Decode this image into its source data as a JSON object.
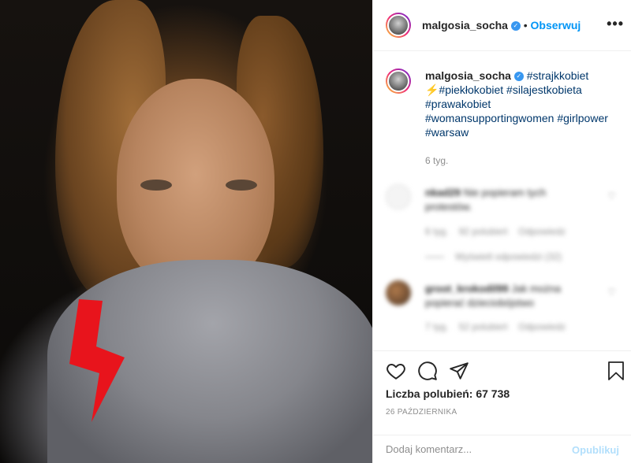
{
  "header": {
    "username": "malgosia_socha",
    "follow_label": "Obserwuj",
    "separator": "•",
    "more_label": "•••"
  },
  "caption": {
    "username": "malgosia_socha",
    "lines": [
      "#strajkkobiet",
      "#piekłokobiet #silajestkobieta",
      "#prawakobiet",
      "#womansupportingwomen #girlpower",
      "#warsaw"
    ],
    "age": "6 tyg."
  },
  "comments": [
    {
      "username": "nkad29",
      "text": "Nie popieram tych",
      "text2": "protestów.",
      "age": "6 tyg.",
      "likes": "92 polubień",
      "reply": "Odpowiedz",
      "view_replies": "Wyświetl odpowiedzi (32)"
    },
    {
      "username": "groot_krokodil99",
      "text": "Jak można",
      "text2": "popierać dzieciobójstwo",
      "age": "7 tyg.",
      "likes": "52 polubień",
      "reply": "Odpowiedz"
    }
  ],
  "actions": {
    "likes_text": "Liczba polubień: 67 738",
    "date": "26 PAŹDZIERNIKA",
    "comment_placeholder": "Dodaj komentarz...",
    "post_label": "Opublikuj"
  },
  "colors": {
    "accent": "#0095f6",
    "verified": "#3897f0",
    "bolt": "#e8141c"
  }
}
